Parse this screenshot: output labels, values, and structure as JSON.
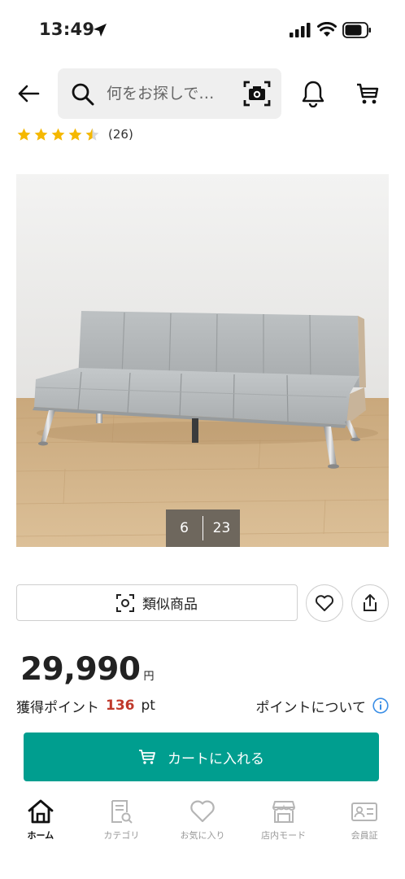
{
  "status_bar": {
    "time": "13:49"
  },
  "header": {
    "search_placeholder": "何をお探しで…"
  },
  "rating": {
    "stars": 4.5,
    "count": "(26)"
  },
  "gallery": {
    "current": "6",
    "total": "23"
  },
  "actions": {
    "similar_label": "類似商品"
  },
  "price": {
    "value": "29,990",
    "unit": "円"
  },
  "points": {
    "label": "獲得ポイント",
    "value": "136",
    "unit": "pt",
    "info_label": "ポイントについて"
  },
  "cart_button": {
    "label": "カートに入れる"
  },
  "bottom_nav": [
    {
      "label": "ホーム",
      "icon": "home-icon",
      "active": true
    },
    {
      "label": "カテゴリ",
      "icon": "category-icon",
      "active": false
    },
    {
      "label": "お気に入り",
      "icon": "heart-icon",
      "active": false
    },
    {
      "label": "店内モード",
      "icon": "store-icon",
      "active": false
    },
    {
      "label": "会員証",
      "icon": "member-card-icon",
      "active": false
    }
  ],
  "colors": {
    "accent": "#009e8f",
    "points": "#c0392b",
    "star": "#f5b800",
    "info": "#3a8ee6"
  }
}
